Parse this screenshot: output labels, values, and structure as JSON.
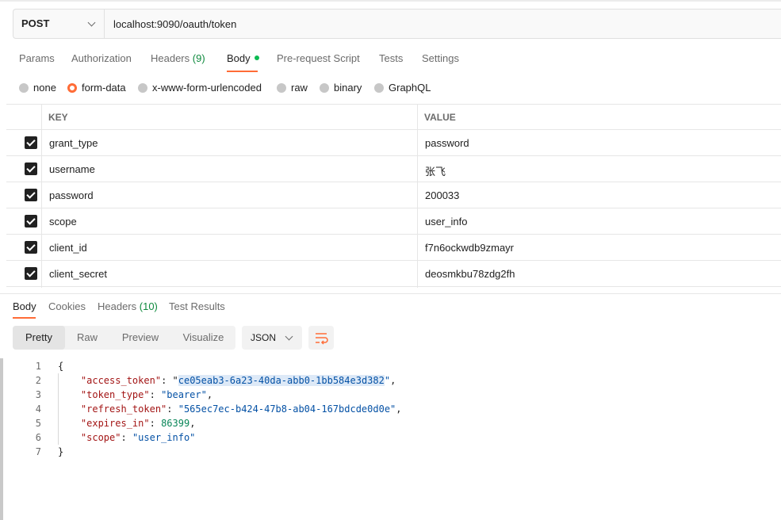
{
  "request": {
    "method": "POST",
    "url": "localhost:9090/oauth/token"
  },
  "request_tabs": {
    "params": "Params",
    "authorization": "Authorization",
    "headers": "Headers",
    "headers_count": "(9)",
    "body": "Body",
    "pre_request": "Pre-request Script",
    "tests": "Tests",
    "settings": "Settings"
  },
  "body_types": {
    "none": "none",
    "form_data": "form-data",
    "urlencoded": "x-www-form-urlencoded",
    "raw": "raw",
    "binary": "binary",
    "graphql": "GraphQL",
    "selected": "form-data"
  },
  "table": {
    "key_header": "KEY",
    "value_header": "VALUE",
    "rows": [
      {
        "key": "grant_type",
        "value": "password",
        "checked": true
      },
      {
        "key": "username",
        "value": "张飞",
        "checked": true
      },
      {
        "key": "password",
        "value": "200033",
        "checked": true
      },
      {
        "key": "scope",
        "value": "user_info",
        "checked": true
      },
      {
        "key": "client_id",
        "value": "f7n6ockwdb9zmayr",
        "checked": true
      },
      {
        "key": "client_secret",
        "value": "deosmkbu78zdg2fh",
        "checked": true
      }
    ]
  },
  "response_tabs": {
    "body": "Body",
    "cookies": "Cookies",
    "headers": "Headers",
    "headers_count": "(10)",
    "test_results": "Test Results"
  },
  "view_modes": {
    "pretty": "Pretty",
    "raw": "Raw",
    "preview": "Preview",
    "visualize": "Visualize"
  },
  "format": "JSON",
  "response_json": {
    "line_numbers": [
      "1",
      "2",
      "3",
      "4",
      "5",
      "6",
      "7"
    ],
    "open_brace": "{",
    "close_brace": "}",
    "access_token_key": "\"access_token\"",
    "access_token_value": "ce05eab3-6a23-40da-abb0-1bb584e3d382",
    "token_type_key": "\"token_type\"",
    "token_type_value": "\"bearer\"",
    "refresh_token_key": "\"refresh_token\"",
    "refresh_token_value": "\"565ec7ec-b424-47b8-ab04-167bdcde0d0e\"",
    "expires_in_key": "\"expires_in\"",
    "expires_in_value": "86399",
    "scope_key": "\"scope\"",
    "scope_value": "\"user_info\""
  },
  "colors": {
    "accent": "#ff6c37",
    "green_dot": "#0cbb52",
    "count_green": "#0f8a3e",
    "json_key": "#a31515",
    "json_string": "#0451a5",
    "json_number": "#098658"
  }
}
